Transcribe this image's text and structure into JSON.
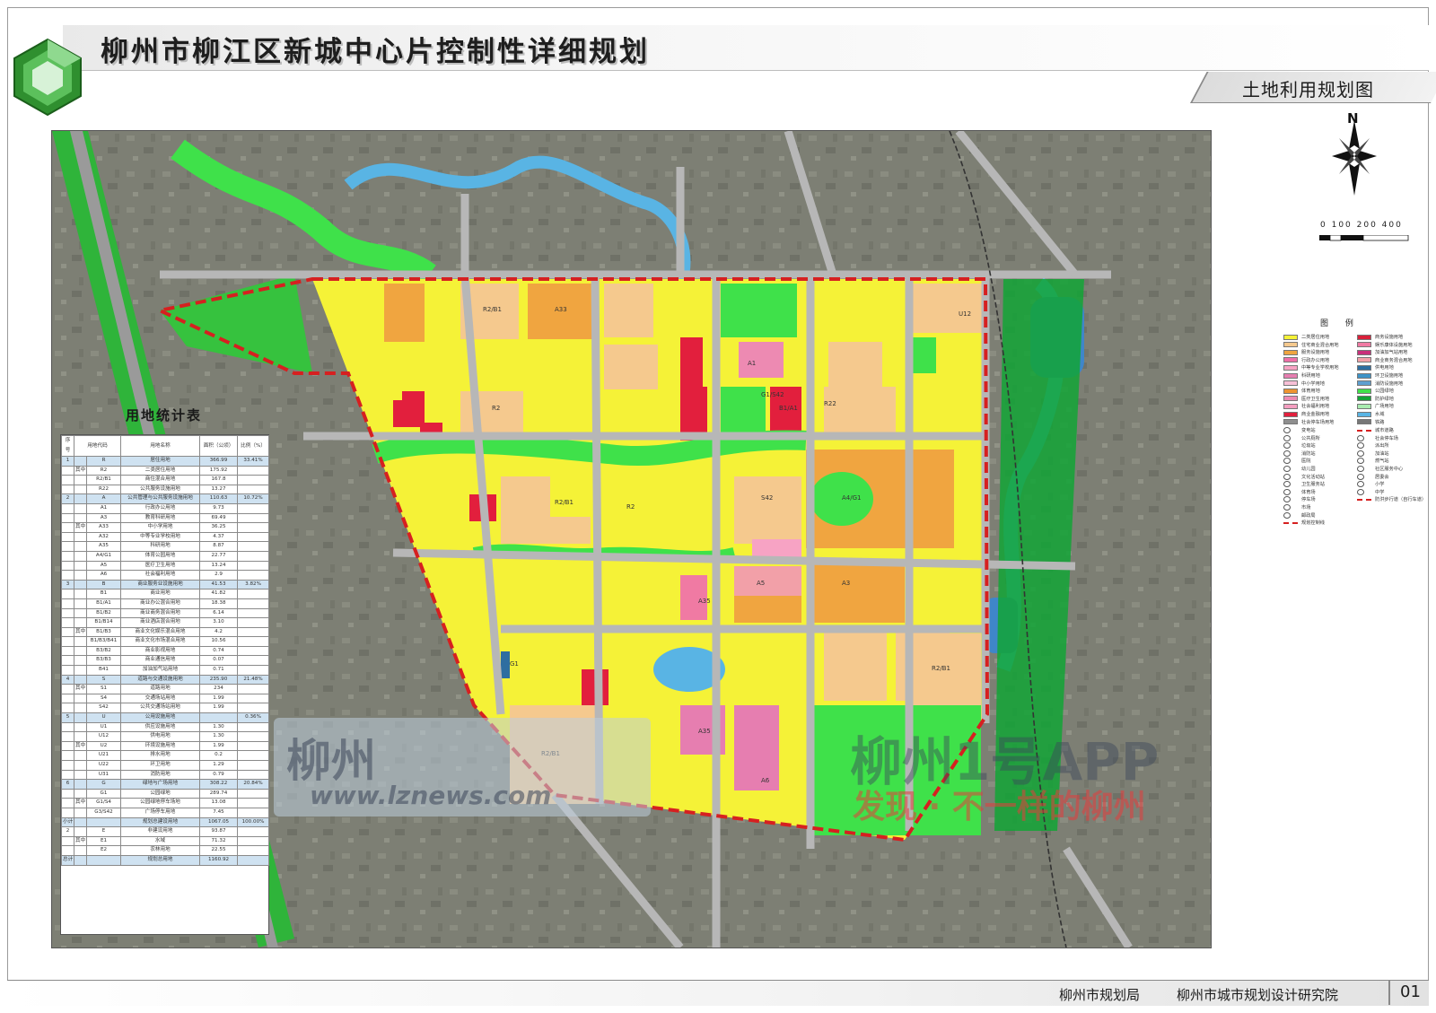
{
  "header": {
    "title": "柳州市柳江区新城中心片控制性详细规划",
    "subtitle": "土地利用规划图"
  },
  "compass": {
    "north_label": "N",
    "scale_label": "0 100 200 400"
  },
  "legend": {
    "title": "图 例",
    "left_items": [
      {
        "label": "二类居住用地",
        "color": "#f5f237"
      },
      {
        "label": "住宅商业混合用地",
        "color": "#f5c98e"
      },
      {
        "label": "服务设施用地",
        "color": "#f0a540"
      },
      {
        "label": "行政办公用地",
        "color": "#ef6ea8"
      },
      {
        "label": "中等专业学校用地",
        "color": "#f7a3c4"
      },
      {
        "label": "科研用地",
        "color": "#e67eb0"
      },
      {
        "label": "中小学用地",
        "color": "#f7c0d7"
      },
      {
        "label": "体育用地",
        "color": "#ee9430"
      },
      {
        "label": "医疗卫生用地",
        "color": "#ed8ab2"
      },
      {
        "label": "社会福利用地",
        "color": "#f49ec0"
      },
      {
        "label": "商业金融用地",
        "color": "#e21f3d"
      },
      {
        "label": "社会停车场用地",
        "color": "#8f8f8f"
      }
    ],
    "right_items": [
      {
        "label": "商务设施用地",
        "color": "#d9203a"
      },
      {
        "label": "娱乐康体设施用地",
        "color": "#f07aa3"
      },
      {
        "label": "加油加气站用地",
        "color": "#c9307b"
      },
      {
        "label": "商业商务混合用地",
        "color": "#f2a0a8"
      },
      {
        "label": "供电用地",
        "color": "#2e6ea0"
      },
      {
        "label": "环卫设施用地",
        "color": "#3e94c8"
      },
      {
        "label": "消防设施用地",
        "color": "#5e9fd0"
      },
      {
        "label": "公园绿地",
        "color": "#3fe14a"
      },
      {
        "label": "防护绿地",
        "color": "#12a436"
      },
      {
        "label": "广场用地",
        "color": "#a9ecb0"
      },
      {
        "label": "水域",
        "color": "#59b4e4"
      },
      {
        "label": "铁路",
        "color": "#777777"
      }
    ],
    "symbol_items_left": [
      "变电站",
      "公共厕所",
      "垃圾站",
      "消防站",
      "医院",
      "幼儿园",
      "文化活动站",
      "卫生服务站",
      "体育场",
      "停车场",
      "市场",
      "邮政局",
      "规划控制线"
    ],
    "symbol_items_right": [
      "城市道路",
      "社会停车场",
      "派出所",
      "加油站",
      "燃气站",
      "社区服务中心",
      "居委会",
      "小学",
      "中学",
      "防洪步行道（自行车道）"
    ]
  },
  "stats_table": {
    "title": "用地统计表",
    "headers": [
      "序号",
      "用地代码",
      "用地名称",
      "面积（公顷）",
      "比例（%）"
    ],
    "rows": [
      {
        "no": "1",
        "sub": "",
        "code": "R",
        "name": "居住用地",
        "area": "366.99",
        "pct": "33.41%",
        "group": true
      },
      {
        "no": "",
        "sub": "其中",
        "code": "R2",
        "name": "二类居住用地",
        "area": "175.92",
        "pct": "",
        "group": false
      },
      {
        "no": "",
        "sub": "",
        "code": "R2/B1",
        "name": "商住混合用地",
        "area": "167.8",
        "pct": "",
        "group": false
      },
      {
        "no": "",
        "sub": "",
        "code": "R22",
        "name": "公共服务设施用地",
        "area": "13.27",
        "pct": "",
        "group": false
      },
      {
        "no": "2",
        "sub": "",
        "code": "A",
        "name": "公共管理与公共服务设施用地",
        "area": "110.63",
        "pct": "10.72%",
        "group": true
      },
      {
        "no": "",
        "sub": "",
        "code": "A1",
        "name": "行政办公用地",
        "area": "9.73",
        "pct": "",
        "group": false
      },
      {
        "no": "",
        "sub": "",
        "code": "A3",
        "name": "教育科研用地",
        "area": "69.49",
        "pct": "",
        "group": false
      },
      {
        "no": "",
        "sub": "其中",
        "code": "A33",
        "name": "中小学用地",
        "area": "36.25",
        "pct": "",
        "group": false
      },
      {
        "no": "",
        "sub": "",
        "code": "A32",
        "name": "中等专业学校用地",
        "area": "4.37",
        "pct": "",
        "group": false
      },
      {
        "no": "",
        "sub": "",
        "code": "A35",
        "name": "科研用地",
        "area": "8.87",
        "pct": "",
        "group": false
      },
      {
        "no": "",
        "sub": "",
        "code": "A4/G1",
        "name": "体育公园用地",
        "area": "22.77",
        "pct": "",
        "group": false
      },
      {
        "no": "",
        "sub": "",
        "code": "A5",
        "name": "医疗卫生用地",
        "area": "13.24",
        "pct": "",
        "group": false
      },
      {
        "no": "",
        "sub": "",
        "code": "A6",
        "name": "社会福利用地",
        "area": "2.9",
        "pct": "",
        "group": false
      },
      {
        "no": "3",
        "sub": "",
        "code": "B",
        "name": "商业服务业设施用地",
        "area": "41.53",
        "pct": "3.82%",
        "group": true
      },
      {
        "no": "",
        "sub": "",
        "code": "B1",
        "name": "商业用地",
        "area": "41.82",
        "pct": "",
        "group": false
      },
      {
        "no": "",
        "sub": "",
        "code": "B1/A1",
        "name": "商业办公混合用地",
        "area": "18.38",
        "pct": "",
        "group": false
      },
      {
        "no": "",
        "sub": "",
        "code": "B1/B2",
        "name": "商业商务混合用地",
        "area": "6.14",
        "pct": "",
        "group": false
      },
      {
        "no": "",
        "sub": "",
        "code": "B1/B14",
        "name": "商业酒店混合用地",
        "area": "3.10",
        "pct": "",
        "group": false
      },
      {
        "no": "",
        "sub": "其中",
        "code": "B1/B3",
        "name": "商业文化娱乐混合用地",
        "area": "4.2",
        "pct": "",
        "group": false
      },
      {
        "no": "",
        "sub": "",
        "code": "B1/B3/B41",
        "name": "商业文化市场混合用地",
        "area": "10.56",
        "pct": "",
        "group": false
      },
      {
        "no": "",
        "sub": "",
        "code": "B3/B2",
        "name": "商业影视用地",
        "area": "0.74",
        "pct": "",
        "group": false
      },
      {
        "no": "",
        "sub": "",
        "code": "B3/B3",
        "name": "商业通信用地",
        "area": "0.07",
        "pct": "",
        "group": false
      },
      {
        "no": "",
        "sub": "",
        "code": "B41",
        "name": "加油加气站用地",
        "area": "0.71",
        "pct": "",
        "group": false
      },
      {
        "no": "4",
        "sub": "",
        "code": "S",
        "name": "道路与交通设施用地",
        "area": "235.90",
        "pct": "21.48%",
        "group": true
      },
      {
        "no": "",
        "sub": "其中",
        "code": "S1",
        "name": "道路用地",
        "area": "234",
        "pct": "",
        "group": false
      },
      {
        "no": "",
        "sub": "",
        "code": "S4",
        "name": "交通场站用地",
        "area": "1.99",
        "pct": "",
        "group": false
      },
      {
        "no": "",
        "sub": "",
        "code": "S42",
        "name": "公共交通场站用地",
        "area": "1.99",
        "pct": "",
        "group": false
      },
      {
        "no": "5",
        "sub": "",
        "code": "U",
        "name": "公用设施用地",
        "area": "",
        "pct": "0.36%",
        "group": true
      },
      {
        "no": "",
        "sub": "",
        "code": "U1",
        "name": "供应设施用地",
        "area": "1.30",
        "pct": "",
        "group": false
      },
      {
        "no": "",
        "sub": "",
        "code": "U12",
        "name": "供电用地",
        "area": "1.30",
        "pct": "",
        "group": false
      },
      {
        "no": "",
        "sub": "其中",
        "code": "U2",
        "name": "环境设施用地",
        "area": "1.99",
        "pct": "",
        "group": false
      },
      {
        "no": "",
        "sub": "",
        "code": "U21",
        "name": "排水用地",
        "area": "0.2",
        "pct": "",
        "group": false
      },
      {
        "no": "",
        "sub": "",
        "code": "U22",
        "name": "环卫用地",
        "area": "1.29",
        "pct": "",
        "group": false
      },
      {
        "no": "",
        "sub": "",
        "code": "U31",
        "name": "消防用地",
        "area": "0.79",
        "pct": "",
        "group": false
      },
      {
        "no": "6",
        "sub": "",
        "code": "G",
        "name": "绿地与广场用地",
        "area": "308.22",
        "pct": "20.84%",
        "group": true
      },
      {
        "no": "",
        "sub": "",
        "code": "G1",
        "name": "公园绿地",
        "area": "289.74",
        "pct": "",
        "group": false
      },
      {
        "no": "",
        "sub": "其中",
        "code": "G1/S4",
        "name": "公园绿地停车场地",
        "area": "13.08",
        "pct": "",
        "group": false
      },
      {
        "no": "",
        "sub": "",
        "code": "G3/S42",
        "name": "广场停车用地",
        "area": "7.45",
        "pct": "",
        "group": false
      },
      {
        "no": "小计",
        "sub": "",
        "code": "",
        "name": "规划总建设用地",
        "area": "1067.05",
        "pct": "100.00%",
        "group": true
      },
      {
        "no": "2",
        "sub": "",
        "code": "E",
        "name": "非建设用地",
        "area": "93.87",
        "pct": "",
        "group": false
      },
      {
        "no": "",
        "sub": "其中",
        "code": "E1",
        "name": "水域",
        "area": "71.32",
        "pct": "",
        "group": false
      },
      {
        "no": "",
        "sub": "",
        "code": "E2",
        "name": "农林用地",
        "area": "22.55",
        "pct": "",
        "group": false
      },
      {
        "no": "总计",
        "sub": "",
        "code": "",
        "name": "规划总用地",
        "area": "1160.92",
        "pct": "",
        "group": true
      }
    ]
  },
  "footer": {
    "org_a": "柳州市规划局",
    "org_b": "柳州市城市规划设计研究院",
    "page": "01"
  },
  "watermark": {
    "line1": "柳州",
    "line2": "www.lznews.com",
    "app_line1": "柳州1号APP",
    "app_line2": "发现 · 不一样的柳州"
  },
  "parcel_labels": [
    "R2",
    "R2/B1",
    "A33",
    "G1",
    "B1/A1",
    "A1",
    "A35",
    "A5",
    "R22",
    "U12",
    "S42",
    "G1/S42",
    "A4/G1",
    "A6",
    "R2/B1",
    "A3"
  ]
}
